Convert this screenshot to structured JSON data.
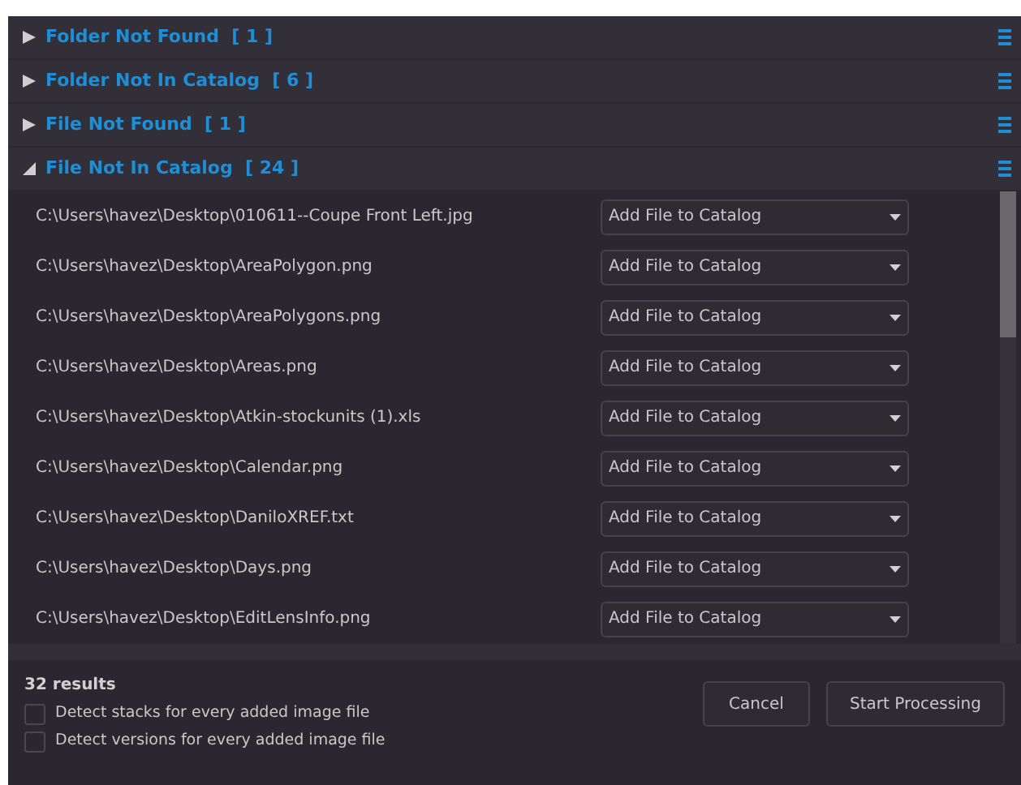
{
  "sections": [
    {
      "title": "Folder Not Found  [ 1 ]",
      "expanded": false
    },
    {
      "title": "Folder Not In Catalog  [ 6 ]",
      "expanded": false
    },
    {
      "title": "File Not Found  [ 1 ]",
      "expanded": false
    },
    {
      "title": "File Not In Catalog  [ 24 ]",
      "expanded": true,
      "rows": [
        {
          "path": "C:\\Users\\havez\\Desktop\\010611--Coupe Front Left.jpg",
          "action": "Add File to Catalog"
        },
        {
          "path": "C:\\Users\\havez\\Desktop\\AreaPolygon.png",
          "action": "Add File to Catalog"
        },
        {
          "path": "C:\\Users\\havez\\Desktop\\AreaPolygons.png",
          "action": "Add File to Catalog"
        },
        {
          "path": "C:\\Users\\havez\\Desktop\\Areas.png",
          "action": "Add File to Catalog"
        },
        {
          "path": "C:\\Users\\havez\\Desktop\\Atkin-stockunits (1).xls",
          "action": "Add File to Catalog"
        },
        {
          "path": "C:\\Users\\havez\\Desktop\\Calendar.png",
          "action": "Add File to Catalog"
        },
        {
          "path": "C:\\Users\\havez\\Desktop\\DaniloXREF.txt",
          "action": "Add File to Catalog"
        },
        {
          "path": "C:\\Users\\havez\\Desktop\\Days.png",
          "action": "Add File to Catalog"
        },
        {
          "path": "C:\\Users\\havez\\Desktop\\EditLensInfo.png",
          "action": "Add File to Catalog"
        }
      ]
    }
  ],
  "footer": {
    "results": "32 results",
    "options": [
      {
        "label": "Detect stacks for every added image file",
        "checked": false
      },
      {
        "label": "Detect versions for every added image file",
        "checked": false
      }
    ],
    "buttons": [
      "Cancel",
      "Start Processing"
    ]
  }
}
